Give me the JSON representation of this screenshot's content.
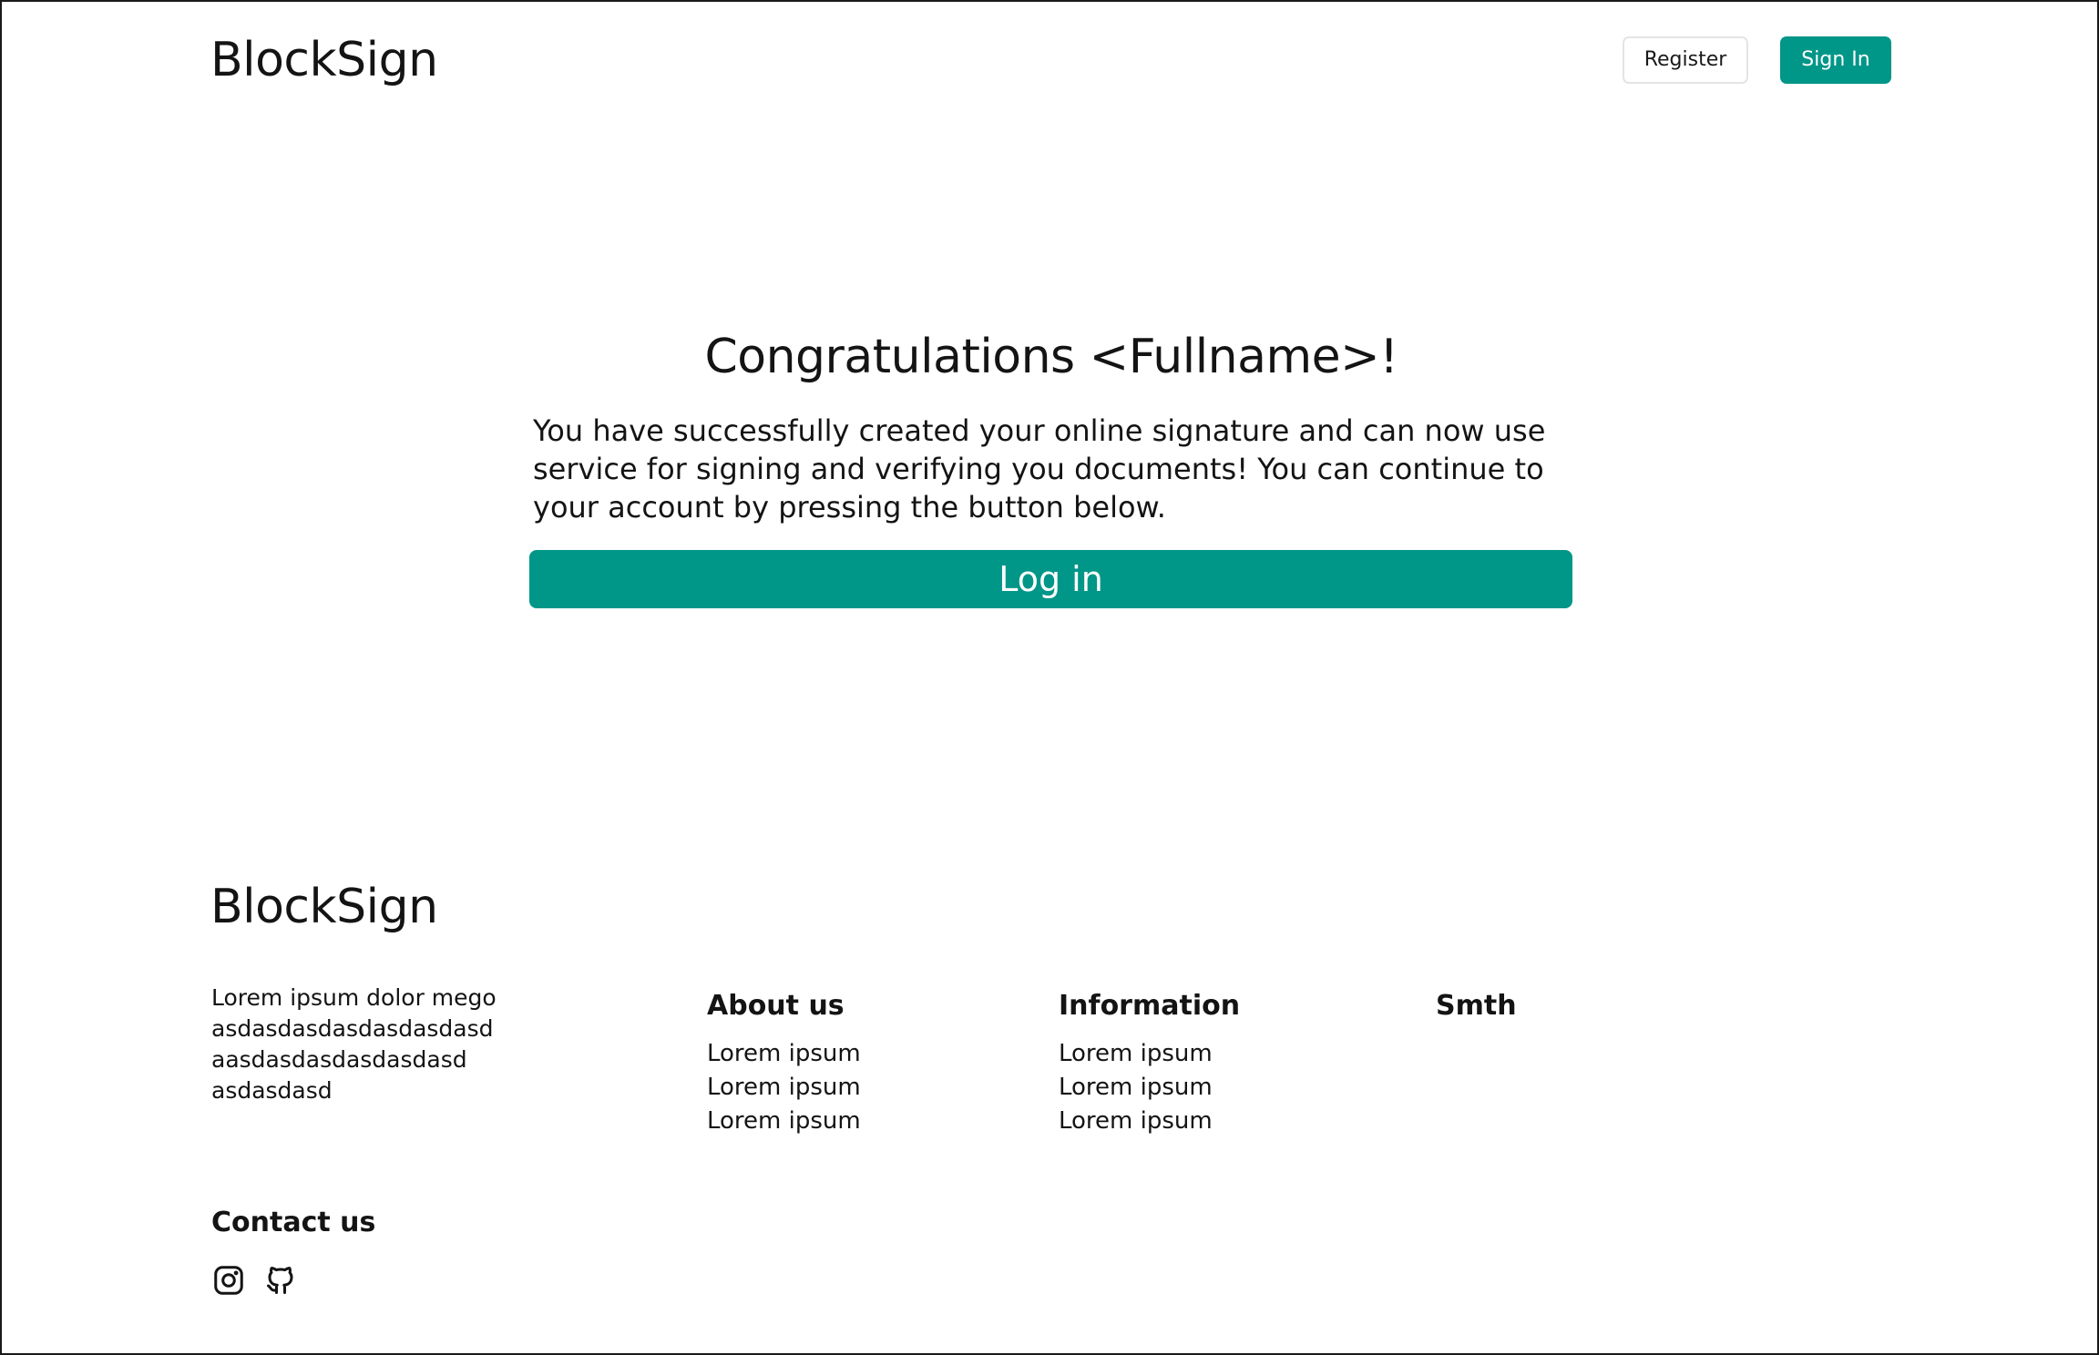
{
  "header": {
    "brand": "BlockSign",
    "register_label": "Register",
    "signin_label": "Sign In"
  },
  "main": {
    "title": "Congratulations <Fullname>!",
    "message": "You have successfully created your online signature and can now use service for signing and verifying you documents! You can continue to your account by pressing the button below.",
    "login_label": "Log in"
  },
  "footer": {
    "brand": "BlockSign",
    "description_lines": [
      "Lorem ipsum dolor mego",
      "asdasdasdasdasdasdasd",
      "aasdasdasdasdasdasd",
      "asdasdasd"
    ],
    "columns": [
      {
        "title": "About us",
        "links": [
          "Lorem ipsum",
          "Lorem ipsum",
          "Lorem ipsum"
        ]
      },
      {
        "title": "Information",
        "links": [
          "Lorem ipsum",
          "Lorem ipsum",
          "Lorem ipsum"
        ]
      },
      {
        "title": "Smth",
        "links": []
      }
    ],
    "contact_title": "Contact us",
    "social_icons": [
      "instagram-icon",
      "github-icon"
    ]
  },
  "colors": {
    "accent": "#009688",
    "text": "#141414",
    "background": "#ffffff"
  }
}
